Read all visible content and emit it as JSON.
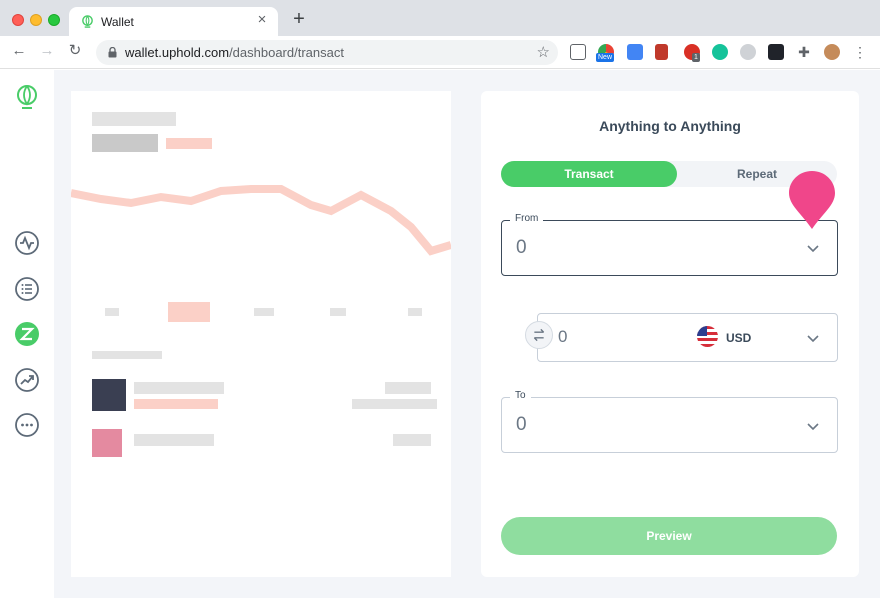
{
  "browser": {
    "tab_title": "Wallet",
    "url_host": "wallet.uphold.com",
    "url_path": "/dashboard/transact",
    "ext_new_badge": "New",
    "ext_count_badge": "1"
  },
  "sidebar": {
    "items": [
      {
        "icon": "uphold-logo-icon"
      },
      {
        "icon": "activity-icon"
      },
      {
        "icon": "list-icon"
      },
      {
        "icon": "transact-icon",
        "active": true
      },
      {
        "icon": "trending-icon"
      },
      {
        "icon": "more-icon"
      }
    ]
  },
  "transact": {
    "title": "Anything to Anything",
    "tabs": {
      "active": "Transact",
      "inactive": "Repeat"
    },
    "from": {
      "label": "From",
      "value": "0"
    },
    "amount": {
      "value": "0",
      "currency": "USD"
    },
    "to": {
      "label": "To",
      "value": "0"
    },
    "preview_label": "Preview"
  },
  "colors": {
    "brand_green": "#49cc68",
    "preview_disabled": "#8fdd9f",
    "marker_pink": "#f0468a",
    "text_dark": "#3b4a5a"
  }
}
